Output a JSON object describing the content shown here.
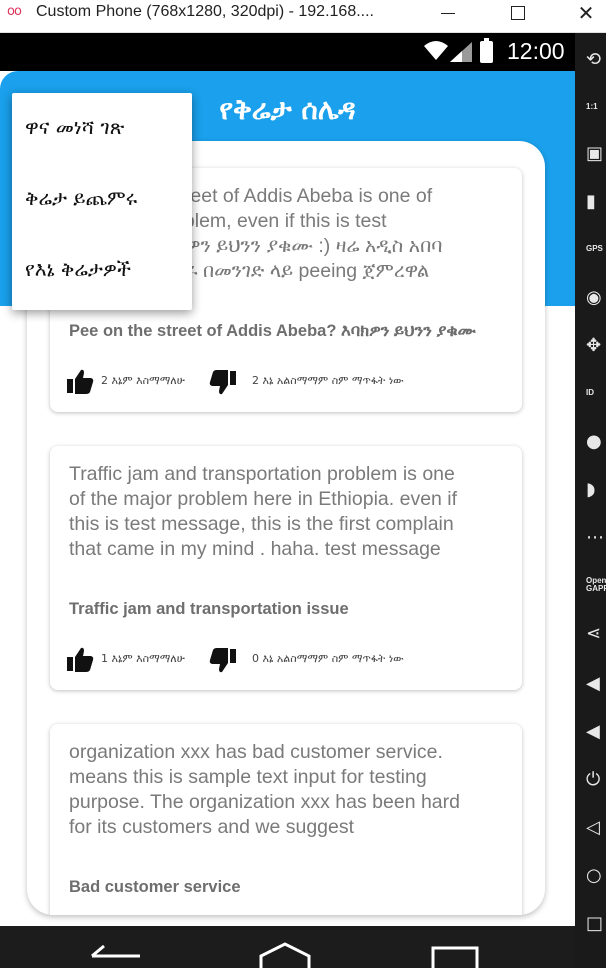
{
  "window": {
    "app_icon": "oo",
    "title": "Custom Phone (768x1280, 320dpi) - 192.168....",
    "minimize_label": "",
    "maximize_label": "",
    "close_label": "✕"
  },
  "status_bar": {
    "time": "12:00",
    "icons": [
      "wifi-icon",
      "signal-icon",
      "battery-icon"
    ]
  },
  "app": {
    "title": "የቅሬታ ሰሌዳ",
    "header_color": "#1aa0ec",
    "menu": {
      "items": [
        {
          "label": "ዋና መነሻ ገጽ"
        },
        {
          "label": "ቅሬታ ይጨምሩ"
        },
        {
          "label": "የእኔ ቅሬታዎች"
        }
      ]
    },
    "posts": [
      {
        "body_lines": [
          "Pee on the street of Addis Abeba is one of",
          "the major problem,  even if this is test",
          "message እባክዎን ይህንን ያቁሙ :) ዛሬ አዲስ አበባ",
          "ውስጥ ሽንት ይቀሩ በመንገድ ላይ peeing ጀምረዋል"
        ],
        "title": "Pee on the street of Addis Abeba? እባክዎን ይህንን ያቁሙ",
        "agree_text": "2 እኔም እስማማለሁ",
        "disagree_text": "2 እኔ አልስማማም ስም ማጥፋት ነው"
      },
      {
        "body_lines": [
          "Traffic jam and transportation problem is one",
          "of the major problem here in Ethiopia. even if",
          "this is test message, this is the first complain",
          "that came in my mind . haha. test message"
        ],
        "title": "Traffic jam and transportation issue",
        "agree_text": "1 እኔም እስማማለሁ",
        "disagree_text": "0 እኔ አልስማማም ስም ማጥፋት ነው"
      },
      {
        "body_lines": [
          "organization xxx has bad customer service.",
          "means this is sample text input for testing",
          "purpose. The organization xxx has been hard",
          "for its customers and we suggest"
        ],
        "title": "Bad customer service",
        "agree_text": "",
        "disagree_text": ""
      }
    ]
  },
  "side_toolbar": {
    "tools": [
      "rotate-icon",
      "dpi-icon",
      "camera-icon",
      "battery-icon",
      "gps-icon",
      "webcam-icon",
      "dpad-icon",
      "id-icon",
      "media-icon",
      "rss-icon",
      "more-icon",
      "opengapps-icon",
      "share-icon",
      "volume-up-icon",
      "volume-down-icon",
      "power-icon",
      "back-icon",
      "home-icon",
      "recents-icon"
    ],
    "labels": {
      "dpi": "1:1",
      "gps": "GPS",
      "id": "ID",
      "opengapps": "Open GAPPS"
    }
  },
  "nav_bar": {
    "buttons": [
      "back-icon",
      "home-icon",
      "recents-icon"
    ]
  },
  "colors": {
    "accent": "#1aa0ec",
    "card_text": "#7a7a7a",
    "title_text": "#6e6e6e"
  }
}
